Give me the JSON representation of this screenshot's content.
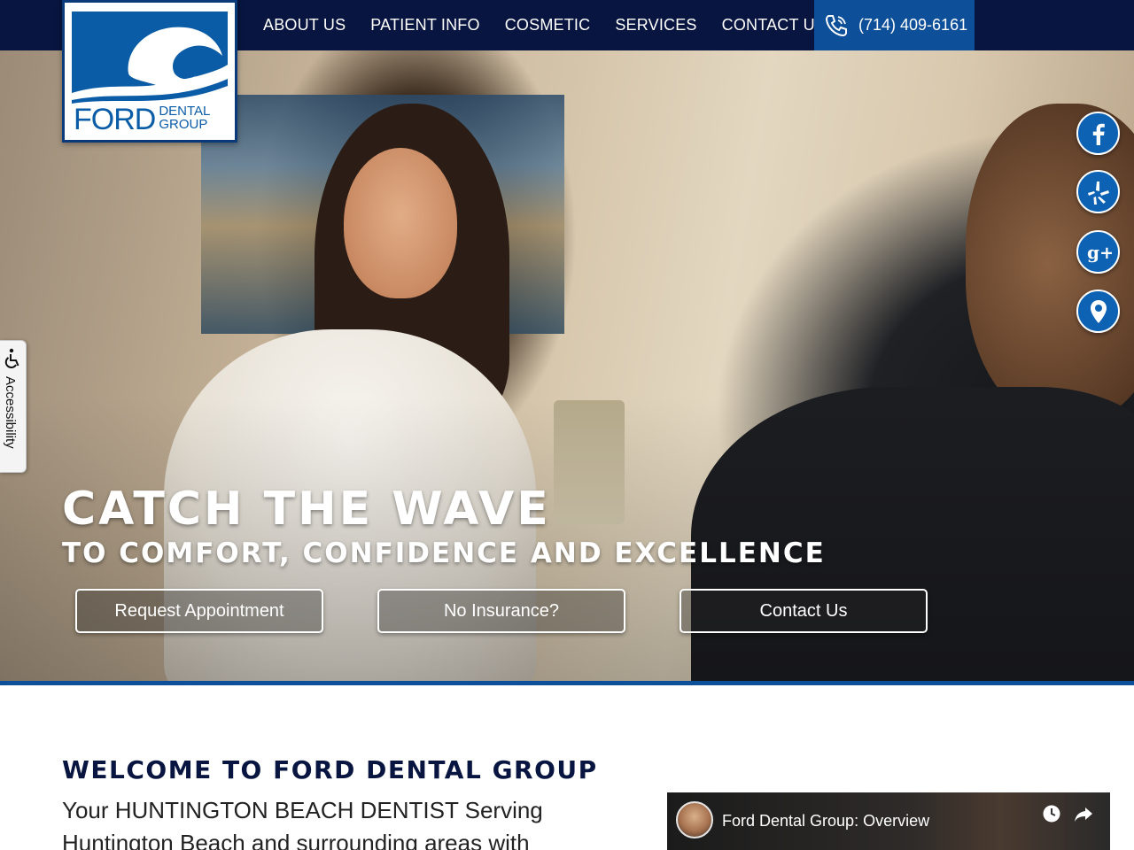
{
  "brand": {
    "logo_main": "FORD",
    "logo_line1": "DENTAL",
    "logo_line2": "GROUP"
  },
  "nav": {
    "items": [
      "ABOUT US",
      "PATIENT INFO",
      "COSMETIC",
      "SERVICES",
      "CONTACT US"
    ],
    "phone": "(714) 409-6161"
  },
  "hero": {
    "title": "CATCH THE WAVE",
    "subtitle": "TO COMFORT, CONFIDENCE AND EXCELLENCE",
    "buttons": [
      "Request Appointment",
      "No Insurance?",
      "Contact Us"
    ]
  },
  "social": {
    "icons": [
      "facebook-icon",
      "yelp-icon",
      "google-plus-icon",
      "map-pin-icon"
    ]
  },
  "accessibility": {
    "label": "Accessibility"
  },
  "welcome": {
    "title": "WELCOME TO FORD DENTAL GROUP",
    "text": "Your HUNTINGTON BEACH DENTIST Serving Huntington Beach and surrounding areas with"
  },
  "video": {
    "title": "Ford Dental Group: Overview"
  },
  "colors": {
    "navy": "#081540",
    "brand_blue": "#0d4f98",
    "social_blue": "#0d62b4"
  }
}
